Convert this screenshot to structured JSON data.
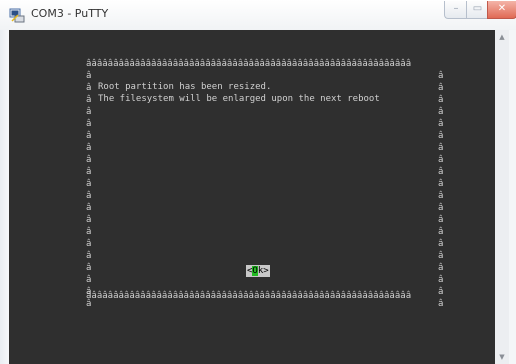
{
  "window": {
    "title": "COM3 - PuTTY"
  },
  "controls": {
    "minimize": "–",
    "maximize": "▭",
    "close": "✕"
  },
  "terminal": {
    "border_char": "â",
    "border_width": 60,
    "inner_rows": 20,
    "lines": [
      "Root partition has been resized.",
      "The filesystem will be enlarged upon the next reboot"
    ],
    "button": {
      "left": "<",
      "mid": "O",
      "right": "k>"
    }
  },
  "colors": {
    "background": "#2f2f2f",
    "text": "#d0d0d0",
    "cursor": "#22bb22"
  },
  "scrollbar": {
    "up": "▲",
    "down": "▼"
  }
}
